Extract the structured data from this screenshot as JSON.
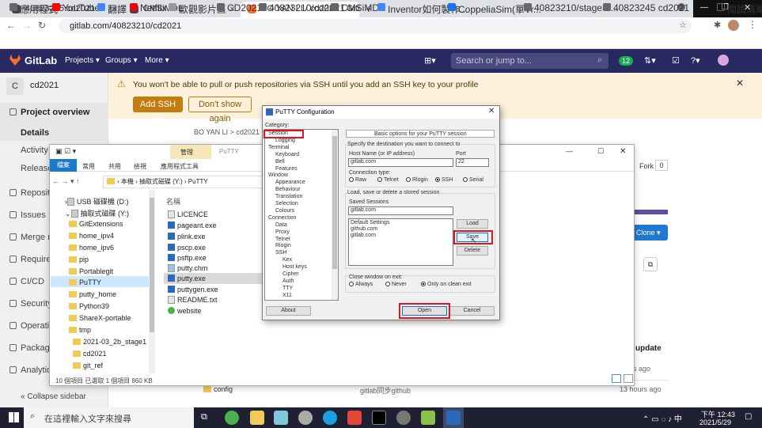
{
  "browser": {
    "tabs": [
      {
        "title": "40823245 cd2021",
        "active": false
      },
      {
        "title": "CMSiMDE",
        "active": false
      },
      {
        "title": "BO YAN LI / cd2021 · GitLab",
        "active": true
      }
    ],
    "new_tab": "+",
    "url": "gitlab.com/40823210/cd2021",
    "bookmarks": [
      "應用程式",
      "YouTube",
      "翻譯",
      "Netflix",
      "歐觀影片區",
      "CD2021",
      "40823210/cd2021",
      "CMSiMDE",
      "Inventor如何製作...",
      "CoppeliaSim(單Vr...",
      "40823210/stage3-...",
      "40823245 cd2021"
    ],
    "reading_list": "閱讀清單"
  },
  "gitlab": {
    "logo": "GitLab",
    "nav": [
      "Projects",
      "Groups",
      "More"
    ],
    "search_placeholder": "Search or jump to...",
    "badge_count": "12",
    "alert": {
      "text": "You won't be able to pull or push repositories via SSH until you add an SSH key to your profile",
      "add_ssh": "Add SSH key",
      "dont_show": "Don't show again"
    },
    "project": {
      "initial": "C",
      "name": "cd2021"
    },
    "breadcrumb": "BO YAN LI  >  cd2021",
    "sidebar": [
      "Project overview",
      "Details",
      "Activity",
      "Releases",
      "Repository",
      "Issues",
      "Merge requests",
      "Requirements",
      "CI/CD",
      "Security & Compliance",
      "Operations",
      "Packages",
      "Analytics"
    ],
    "collapse": "Collapse sidebar",
    "fork": "Fork",
    "fork_count": "0",
    "clone": "Clone",
    "last_update": "update",
    "rows": [
      {
        "name": "config",
        "message": "gitlab同步github",
        "time": "13 hours ago"
      }
    ],
    "ago": "hs ago"
  },
  "explorer": {
    "title": "PuTTY",
    "manage_tab": "管理",
    "ribbon": [
      "檔案",
      "常用",
      "共用",
      "檢視",
      "應用程式工具"
    ],
    "path": [
      "本機",
      "抽取式磁碟 (Y:)",
      "PuTTY"
    ],
    "column_header": "名稱",
    "tree": [
      "USB 磁碟機 (D:)",
      "抽取式磁碟 (Y:)",
      "GitExtensions",
      "home_ipv4",
      "home_ipv6",
      "pip",
      "Portablegit",
      "PuTTY",
      "putty_home",
      "Python39",
      "ShareX-portable",
      "tmp",
      "2021-03_2b_stage1",
      "cd2021",
      "git_ref"
    ],
    "files": [
      "LICENCE",
      "pageant.exe",
      "plink.exe",
      "pscp.exe",
      "psftp.exe",
      "putty.chm",
      "putty.exe",
      "puttygen.exe",
      "README.txt",
      "website"
    ],
    "status": "10 個項目    已選取 1 個項目  860 KB"
  },
  "putty": {
    "title": "PuTTY Configuration",
    "category_label": "Category:",
    "tree": [
      {
        "label": "Session",
        "level": 0
      },
      {
        "label": "Logging",
        "level": 1
      },
      {
        "label": "Terminal",
        "level": 0
      },
      {
        "label": "Keyboard",
        "level": 1
      },
      {
        "label": "Bell",
        "level": 1
      },
      {
        "label": "Features",
        "level": 1
      },
      {
        "label": "Window",
        "level": 0
      },
      {
        "label": "Appearance",
        "level": 1
      },
      {
        "label": "Behaviour",
        "level": 1
      },
      {
        "label": "Translation",
        "level": 1
      },
      {
        "label": "Selection",
        "level": 1
      },
      {
        "label": "Colours",
        "level": 1
      },
      {
        "label": "Connection",
        "level": 0
      },
      {
        "label": "Data",
        "level": 1
      },
      {
        "label": "Proxy",
        "level": 1
      },
      {
        "label": "Telnet",
        "level": 1
      },
      {
        "label": "Rlogin",
        "level": 1
      },
      {
        "label": "SSH",
        "level": 1
      },
      {
        "label": "Kex",
        "level": 2
      },
      {
        "label": "Host keys",
        "level": 2
      },
      {
        "label": "Cipher",
        "level": 2
      },
      {
        "label": "Auth",
        "level": 2
      },
      {
        "label": "TTY",
        "level": 2
      },
      {
        "label": "X11",
        "level": 2
      }
    ],
    "header": "Basic options for your PuTTY session",
    "destination_label": "Specify the destination you want to connect to",
    "host_label": "Host Name (or IP address)",
    "port_label": "Port",
    "host_value": "gitlab.com",
    "port_value": "22",
    "conn_type_label": "Connection type:",
    "conn_types": [
      "Raw",
      "Telnet",
      "Rlogin",
      "SSH",
      "Serial"
    ],
    "conn_selected": "SSH",
    "sessions_group": "Load, save or delete a stored session",
    "saved_label": "Saved Sessions",
    "saved_value": "gitlab.com",
    "sessions": [
      "Default Settings",
      "github.com",
      "gitlab.com"
    ],
    "load": "Load",
    "save": "Save",
    "delete": "Delete",
    "close_label": "Close window on exit:",
    "close_options": [
      "Always",
      "Never",
      "Only on clean exit"
    ],
    "close_selected": "Only on clean exit",
    "about": "About",
    "open": "Open",
    "cancel": "Cancel"
  },
  "taskbar": {
    "search": "在這裡輸入文字來搜尋",
    "time": "下午 12:43",
    "date": "2021/5/29"
  },
  "colors": {
    "gitlab_nav": "#292961",
    "accent": "#fc6d26",
    "warning": "#c17d10",
    "highlight": "#e2141f"
  }
}
